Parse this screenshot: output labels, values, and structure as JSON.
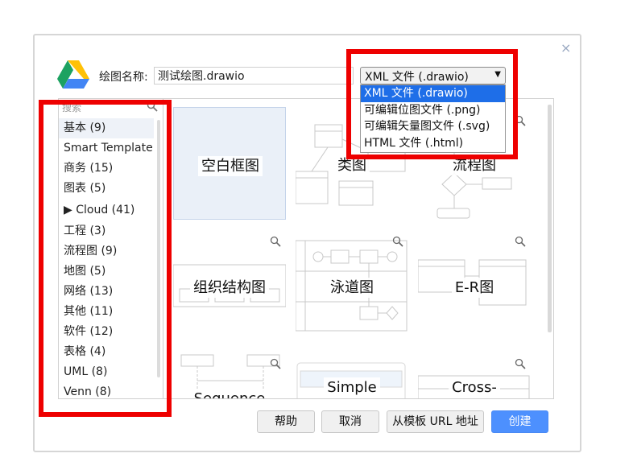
{
  "dialog": {
    "title_label": "绘图名称:",
    "filename": "测试绘图.drawio",
    "close_glyph": "×"
  },
  "format": {
    "selected": "XML 文件 (.drawio)",
    "options": [
      "XML 文件 (.drawio)",
      "可编辑位图文件 (.png)",
      "可编辑矢量图文件 (.svg)",
      "HTML 文件 (.html)"
    ]
  },
  "search": {
    "placeholder": "搜索"
  },
  "categories": [
    "基本 (9)",
    "Smart Template",
    "商务 (15)",
    "图表 (5)",
    "▶ Cloud (41)",
    "工程 (3)",
    "流程图 (9)",
    "地图 (5)",
    "网络 (13)",
    "其他 (11)",
    "软件 (12)",
    "表格 (4)",
    "UML (8)",
    "Venn (8)"
  ],
  "templates": [
    "空白框图",
    "类图",
    "流程图",
    "组织结构图",
    "泳道图",
    "E-R图",
    "Sequence",
    "Simple",
    "Cross-"
  ],
  "buttons": {
    "help": "帮助",
    "cancel": "取消",
    "from_url": "从模板 URL 地址",
    "create": "创建"
  },
  "colors": {
    "highlight_box": "#ee0000",
    "create_button": "#4d90fe",
    "selected_option": "#1e6ee8"
  },
  "icons": [
    "google-drive-icon",
    "search-icon",
    "zoom-icon",
    "close-icon",
    "chevron-down-icon"
  ]
}
